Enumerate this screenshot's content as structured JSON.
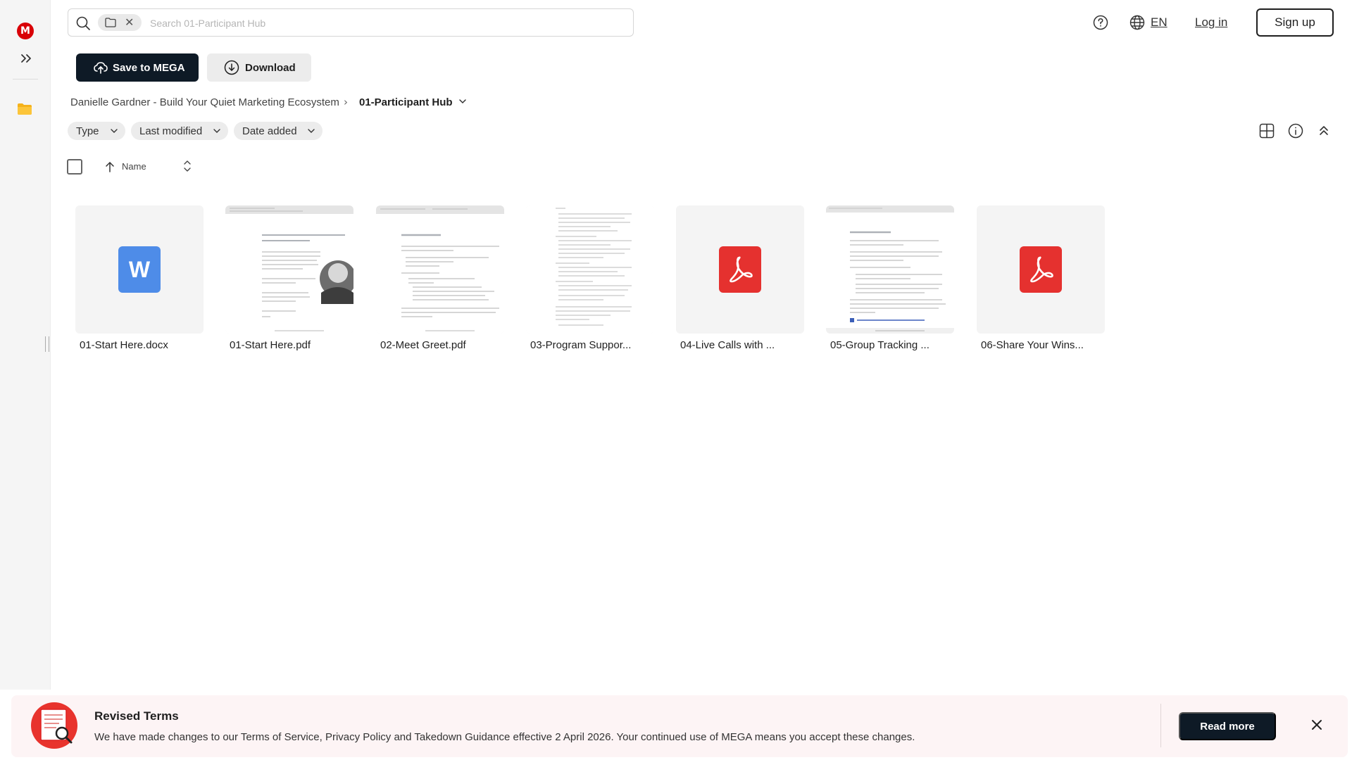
{
  "brand": {
    "logo_letter": "M",
    "accent": "#d90007",
    "dark": "#0e1a26"
  },
  "search": {
    "placeholder": "Search 01-Participant Hub",
    "value": ""
  },
  "header": {
    "language": "EN",
    "login_label": "Log in",
    "signup_label": "Sign up"
  },
  "actions": {
    "save_label": "Save to MEGA",
    "download_label": "Download"
  },
  "breadcrumb": {
    "parent": "Danielle Gardner - Build Your Quiet Marketing Ecosystem",
    "separator": "›",
    "current": "01-Participant Hub"
  },
  "filters": {
    "type_label": "Type",
    "modified_label": "Last modified",
    "added_label": "Date added"
  },
  "list_header": {
    "name_label": "Name"
  },
  "files": [
    {
      "name": "01-Start Here.docx",
      "kind": "word"
    },
    {
      "name": "01-Start Here.pdf",
      "kind": "pdf-preview"
    },
    {
      "name": "02-Meet Greet.pdf",
      "kind": "pdf-preview"
    },
    {
      "name": "03-Program Suppor...",
      "kind": "pdf-preview"
    },
    {
      "name": "04-Live Calls with ...",
      "kind": "pdf"
    },
    {
      "name": "05-Group Tracking ...",
      "kind": "pdf-preview"
    },
    {
      "name": "06-Share Your Wins...",
      "kind": "pdf"
    }
  ],
  "file_icons": {
    "word_letter": "W",
    "word_color": "#4e8ce8",
    "pdf_color": "#e5312f"
  },
  "banner": {
    "title": "Revised Terms",
    "text": "We have made changes to our Terms of Service, Privacy Policy and Takedown Guidance effective 2 April 2026. Your continued use of MEGA means you accept these changes.",
    "read_more_label": "Read more"
  }
}
